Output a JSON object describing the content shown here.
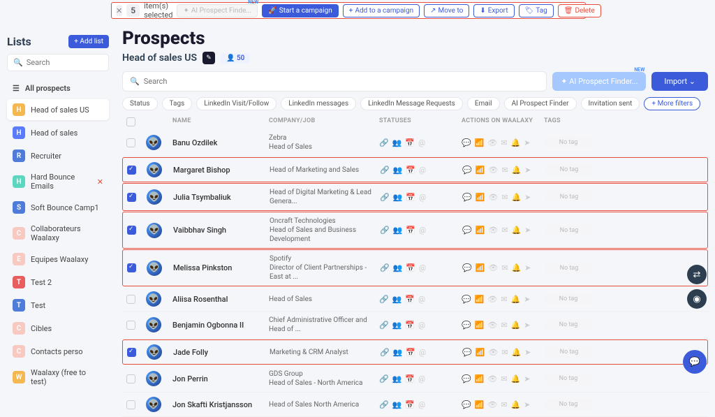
{
  "action_bar": {
    "count": "5",
    "selected_label": "item(s) selected",
    "ai_btn": "AI Prospect Finde...",
    "new_badge": "NEW",
    "start_campaign": "Start a campaign",
    "add_campaign": "Add to a campaign",
    "move_to": "Move to",
    "export": "Export",
    "tag": "Tag",
    "delete": "Delete"
  },
  "sidebar": {
    "title": "Lists",
    "add_list": "+  Add list",
    "search_placeholder": "Search",
    "all_prospects": "All prospects",
    "items": [
      {
        "badge": "H",
        "color": "#f5b74f",
        "label": "Head of sales US",
        "active": true
      },
      {
        "badge": "H",
        "color": "#5b7cfa",
        "label": "Head of sales"
      },
      {
        "badge": "R",
        "color": "#4f7bd9",
        "label": "Recruiter"
      },
      {
        "badge": "H",
        "color": "#5dd6c0",
        "label": "Hard Bounce Emails",
        "extra": "✕"
      },
      {
        "badge": "S",
        "color": "#4f7bd9",
        "label": "Soft Bounce Camp1"
      },
      {
        "badge": "C",
        "color": "#f8c9c0",
        "label": "Collaborateurs Waalaxy"
      },
      {
        "badge": "E",
        "color": "#f8c9c0",
        "label": "Equipes Waalaxy"
      },
      {
        "badge": "T",
        "color": "#e85d5d",
        "label": "Test 2"
      },
      {
        "badge": "T",
        "color": "#4f7bd9",
        "label": "Test"
      },
      {
        "badge": "C",
        "color": "#f8c9c0",
        "label": "Cibles"
      },
      {
        "badge": "C",
        "color": "#f8c9c0",
        "label": "Contacts perso"
      },
      {
        "badge": "W",
        "color": "#f5b74f",
        "label": "Waalaxy (free to test)"
      }
    ]
  },
  "main": {
    "title": "Prospects",
    "subtitle": "Head of sales US",
    "count": "50",
    "search_placeholder": "Search",
    "ai_finder": "AI Prospect Finder...",
    "import": "Import",
    "filters": [
      "Status",
      "Tags",
      "LinkedIn Visit/Follow",
      "LinkedIn messages",
      "LinkedIn Message Requests",
      "Email",
      "AI Prospect Finder",
      "Invitation sent"
    ],
    "more_filters": "More filters",
    "columns": {
      "name": "NAME",
      "company": "COMPANY/JOB",
      "statuses": "STATUSES",
      "actions": "ACTIONS ON WAALAXY",
      "tags": "TAGS"
    },
    "no_tag": "No tag",
    "rows": [
      {
        "checked": false,
        "hl": false,
        "name": "Banu Ozdilek",
        "company": "Zebra",
        "job": "Head of Sales"
      },
      {
        "checked": true,
        "hl": true,
        "name": "Margaret Bishop",
        "company": "",
        "job": "Head of Marketing and Sales"
      },
      {
        "checked": true,
        "hl": true,
        "name": "Julia Tsymbaliuk",
        "company": "",
        "job": "Head of Digital Marketing & Lead Genera..."
      },
      {
        "checked": true,
        "hl": true,
        "name": "Vaibbhav Singh",
        "company": "Oncraft Technologies",
        "job": "Head of Sales and Business Development"
      },
      {
        "checked": true,
        "hl": true,
        "name": "Melissa Pinkston",
        "company": "Spotify",
        "job": "Director of Client Partnerships - East at ..."
      },
      {
        "checked": false,
        "hl": false,
        "name": "Aliisa Rosenthal",
        "company": "",
        "job": "Head of Sales"
      },
      {
        "checked": false,
        "hl": false,
        "name": "Benjamin Ogbonna II",
        "company": "",
        "job": "Chief Administrative Officer and Head of ..."
      },
      {
        "checked": true,
        "hl": true,
        "name": "Jade Folly",
        "company": "",
        "job": "Marketing & CRM Analyst"
      },
      {
        "checked": false,
        "hl": false,
        "name": "Jon Perrin",
        "company": "GDS Group",
        "job": "Head of Sales - North America"
      },
      {
        "checked": false,
        "hl": false,
        "name": "Jon Skafti Kristjansson",
        "company": "",
        "job": "Head of Sales North America"
      }
    ]
  }
}
